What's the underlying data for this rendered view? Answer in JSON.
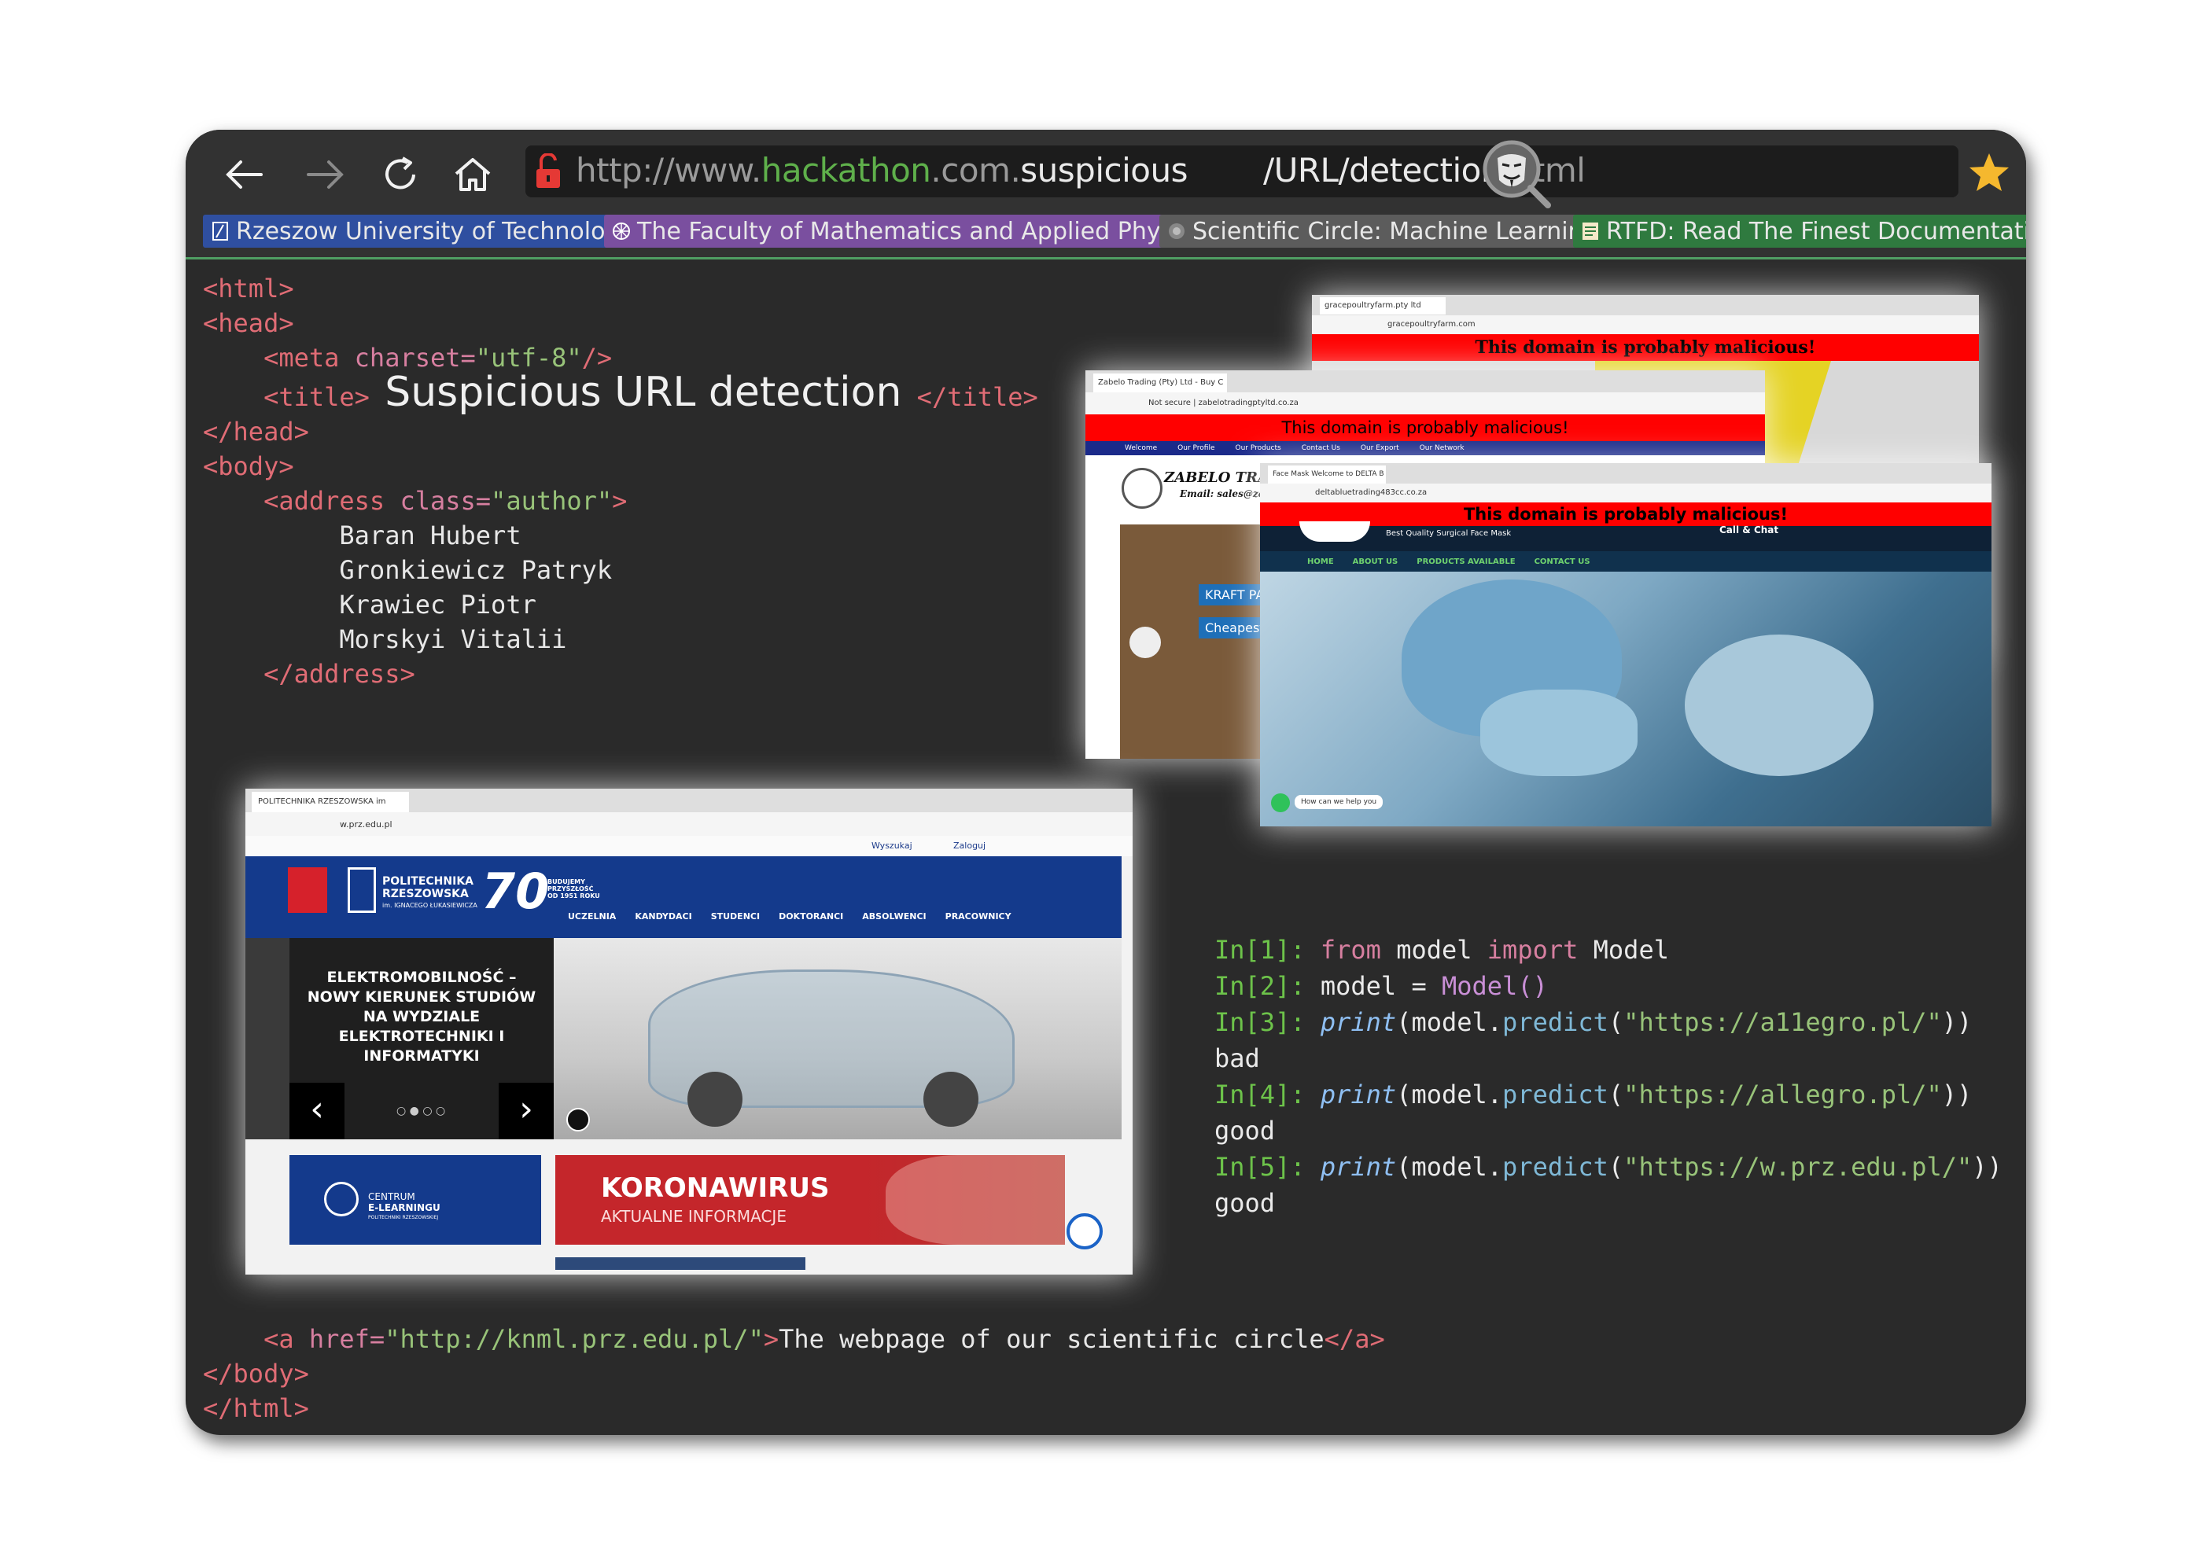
{
  "browser": {
    "url_parts": [
      "http://www.",
      "hackathon",
      ".com.",
      "suspicious",
      "/URL/detection",
      ".html"
    ],
    "bookmarks": [
      {
        "label": "Rzeszow University of Technology",
        "color": "#2f4fa0"
      },
      {
        "label": "The Faculty of Mathematics and Applied Physics",
        "color": "#7a4f9f"
      },
      {
        "label": "Scientific Circle: Machine Learning",
        "color": "#5c5c5c"
      },
      {
        "label": "RTFD: Read The Finest Documentation",
        "color": "#2f7a3f"
      }
    ],
    "icons": [
      "back-arrow-icon",
      "forward-arrow-icon",
      "reload-icon",
      "home-icon",
      "unlocked-padlock-icon",
      "anonymous-mask-icon",
      "star-icon"
    ]
  },
  "html_code": {
    "l1": "<html>",
    "l2": "<head>",
    "meta_open": "<meta ",
    "meta_attr": "charset=",
    "meta_val": "\"utf-8\"",
    "meta_close": "/>",
    "title_open": "<title>",
    "title_text": "Suspicious URL detection",
    "title_close": "</title>",
    "head_close": "</head>",
    "body_open": "<body>",
    "address_open": "<address ",
    "address_attr": "class=",
    "address_val": "\"author\"",
    "address_gt": ">",
    "authors": [
      "Baran Hubert",
      "Gronkiewicz Patryk",
      "Krawiec Piotr",
      "Morskyi Vitalii"
    ],
    "address_close": "</address>",
    "a_open": "<a ",
    "a_attr": "href=",
    "a_val": "\"http://knml.prz.edu.pl/\"",
    "a_gt": ">",
    "a_text": "The webpage of our scientific circle",
    "a_close": "</a>",
    "body_close": "</body>",
    "html_close": "</html>"
  },
  "python": {
    "lines": [
      {
        "prompt": "In[1]:",
        "kw1": "from",
        "t1": " model ",
        "kw2": "import",
        "t2": " Model"
      },
      {
        "prompt": "In[2]:",
        "t1": " model = ",
        "cls": "Model()"
      },
      {
        "prompt": "In[3]:",
        "fn": "print",
        "t1": "(model.",
        "mth": "predict",
        "t2": "(",
        "s": "\"https://a11egro.pl/\"",
        "t3": "))"
      },
      {
        "out": "bad"
      },
      {
        "prompt": "In[4]:",
        "fn": "print",
        "t1": "(model.",
        "mth": "predict",
        "t2": "(",
        "s": "\"https://allegro.pl/\"",
        "t3": "))"
      },
      {
        "out": "good"
      },
      {
        "prompt": "In[5]:",
        "fn": "print",
        "t1": "(model.",
        "mth": "predict",
        "t2": "(",
        "s": "\"https://w.prz.edu.pl/\"",
        "t3": "))"
      },
      {
        "out": "good"
      }
    ]
  },
  "screenshots": {
    "mal1": {
      "tab": "gracepoultryfarm.pty ltd",
      "addr": "gracepoultryfarm.com",
      "warning": "This domain is probably malicious!"
    },
    "mal2": {
      "tab": "Zabelo Trading (Pty) Ltd - Buy C",
      "addr": "Not secure  |  zabelotradingptyltd.co.za",
      "warning": "This domain is probably malicious!",
      "nav": [
        "Welcome",
        "Our Profile",
        "Our Products",
        "Contact Us",
        "Our Export",
        "Our Network"
      ],
      "brand": "ZABELO TRADI",
      "email": "Email: sales@zabel",
      "label1": "KRAFT PA",
      "label2": "Cheapest K"
    },
    "mal3": {
      "tab": "Face Mask Welcome to DELTA B",
      "addr": "deltabluetrading483cc.co.za",
      "warning": "This domain is probably malicious!",
      "tagline": "Best Quality Surgical Face Mask",
      "chat": "Call & Chat",
      "nav": [
        "HOME",
        "ABOUT US",
        "PRODUCTS AVAILABLE",
        "CONTACT US"
      ],
      "help": "How can we help you"
    },
    "prz": {
      "tab": "POLITECHNIKA RZESZOWSKA im",
      "addr": "w.prz.edu.pl",
      "search": "Wyszukaj",
      "login": "Zaloguj",
      "brand1": "POLITECHNIKA",
      "brand2": "RZESZOWSKA",
      "brand3": "im. IGNACEGO ŁUKASIEWICZA",
      "anniv": "70",
      "anniv_text": "BUDUJEMY PRZYSZŁOŚĆ OD 1951 ROKU",
      "nav": [
        "UCZELNIA",
        "KANDYDACI",
        "STUDENCI",
        "DOKTORANCI",
        "ABSOLWENCI",
        "PRACOWNICY"
      ],
      "headline": "ELEKTROMOBILNOŚĆ – NOWY KIERUNEK STUDIÓW NA WYDZIALE ELEKTROTECHNIKI I INFORMATYKI",
      "elearn1": "CENTRUM",
      "elearn2": "E-LEARNINGU",
      "elearn3": "POLITECHNIKI RZESZOWSKIEJ",
      "covid1": "KORONAWIRUS",
      "covid2": "AKTUALNE INFORMACJE"
    }
  }
}
